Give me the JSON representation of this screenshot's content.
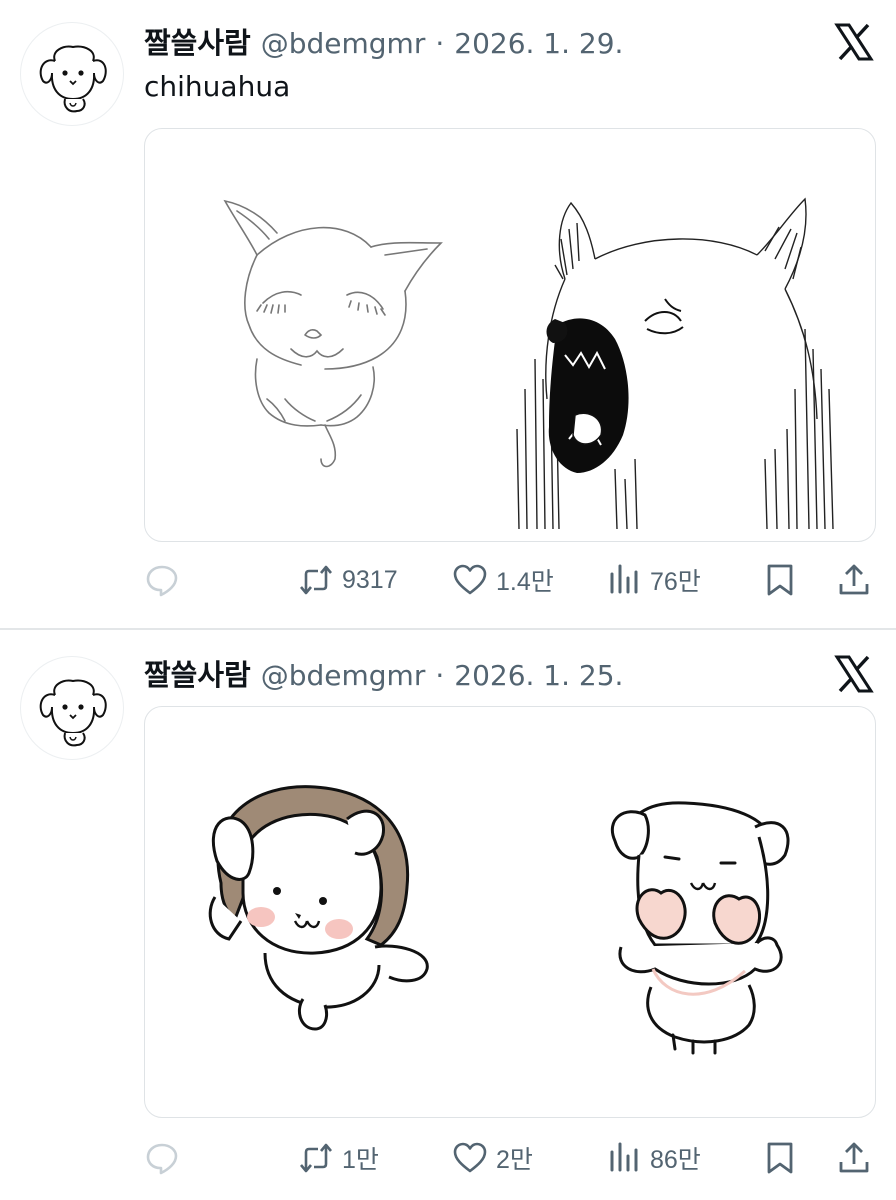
{
  "colors": {
    "text": "#0f1419",
    "muted": "#536471",
    "border": "#dfe3e6",
    "reply_faded": "#c8d0d6",
    "blush": "#f6c5c0",
    "hood": "#9f8a76"
  },
  "tweets": [
    {
      "author_name": "짤쓸사람",
      "handle": "@bdemgmr",
      "separator": "·",
      "date": "2026. 1. 29.",
      "text": "chihuahua",
      "media_icons": [
        "calm-chihuahua-drawing",
        "screaming-chihuahua-drawing"
      ],
      "reply_count": "",
      "retweet_count": "9317",
      "like_count": "1.4만",
      "view_count": "76만"
    },
    {
      "author_name": "짤쓸사람",
      "handle": "@bdemgmr",
      "separator": "·",
      "date": "2026. 1. 25.",
      "text": "",
      "media_icons": [
        "puppy-earmuffs-drawing",
        "puppy-mittens-drawing"
      ],
      "reply_count": "",
      "retweet_count": "1만",
      "like_count": "2만",
      "view_count": "86만"
    }
  ]
}
